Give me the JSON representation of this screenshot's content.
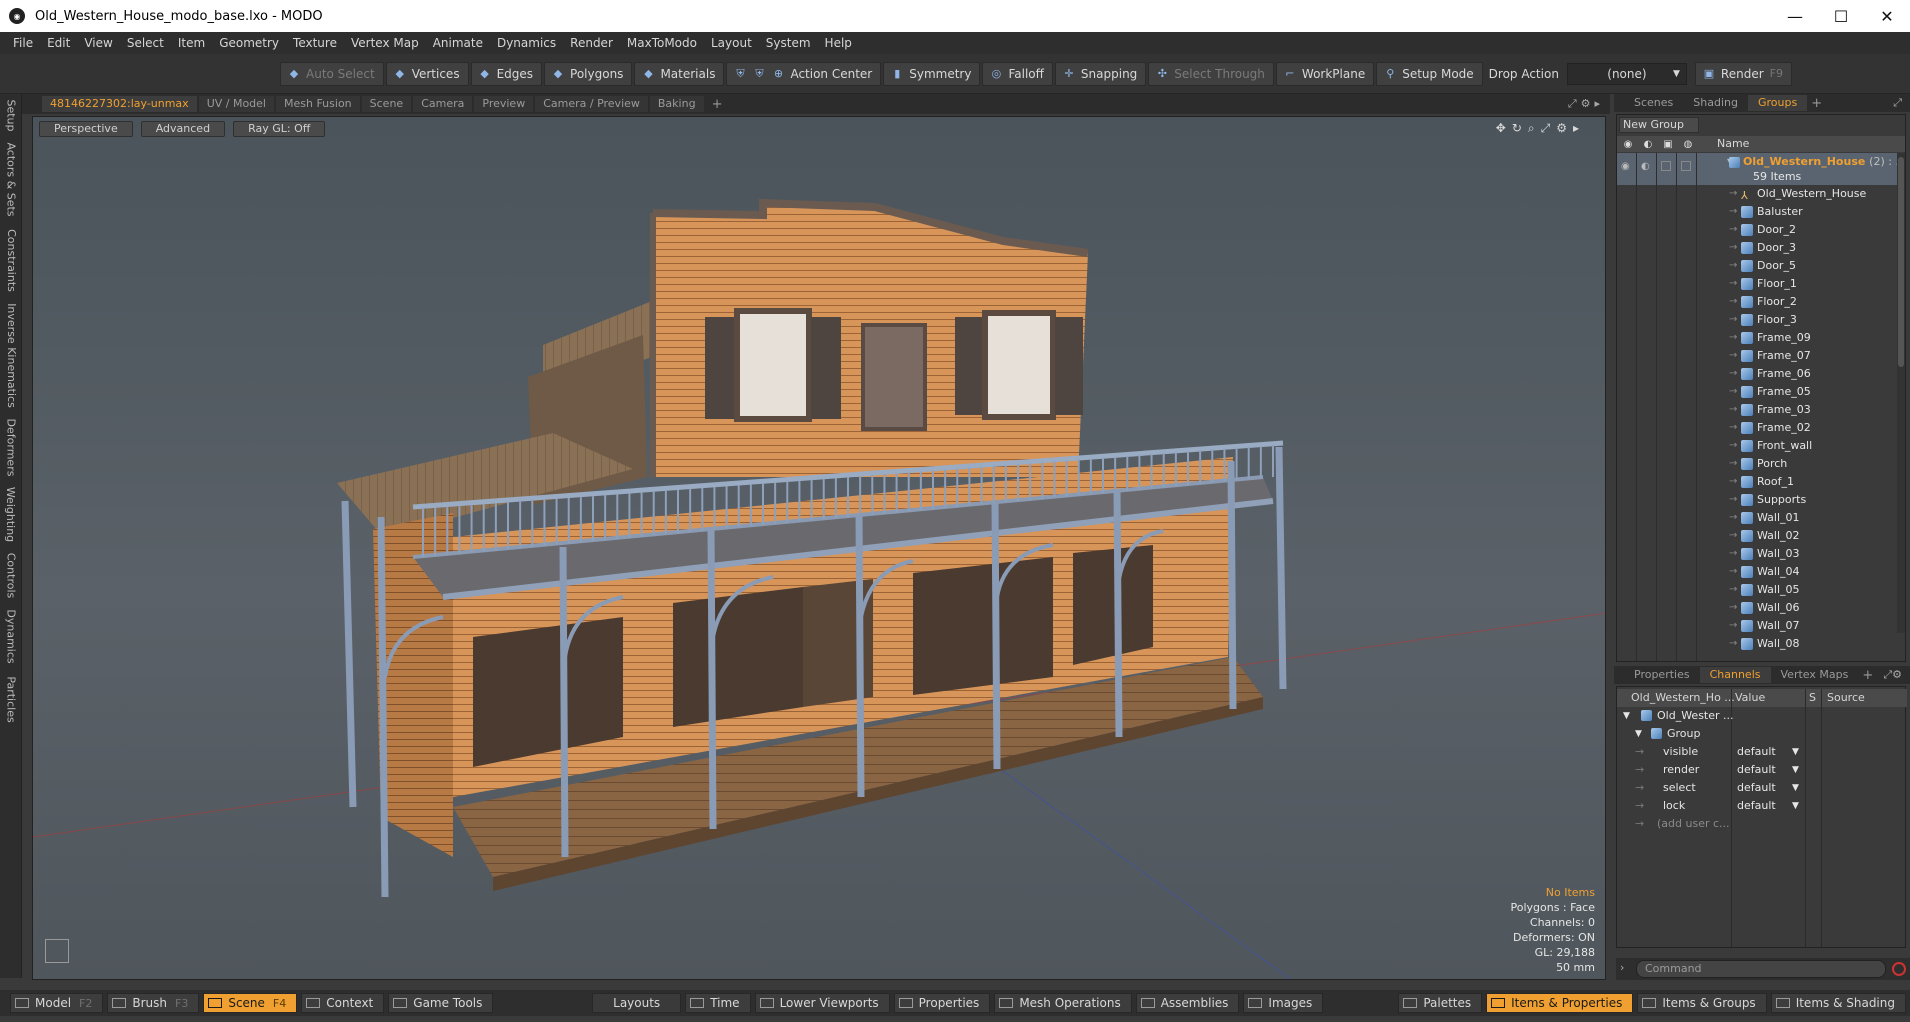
{
  "window": {
    "title": "Old_Western_House_modo_base.lxo - MODO",
    "minimize": "—",
    "maximize": "☐",
    "close": "✕"
  },
  "menu": [
    "File",
    "Edit",
    "View",
    "Select",
    "Item",
    "Geometry",
    "Texture",
    "Vertex Map",
    "Animate",
    "Dynamics",
    "Render",
    "MaxToModo",
    "Layout",
    "System",
    "Help"
  ],
  "toolbar": {
    "auto_select": "Auto Select",
    "vertices": "Vertices",
    "edges": "Edges",
    "polygons": "Polygons",
    "materials": "Materials",
    "action_center": "Action Center",
    "symmetry": "Symmetry",
    "falloff": "Falloff",
    "snapping": "Snapping",
    "select_through": "Select Through",
    "workplane": "WorkPlane",
    "setup_mode": "Setup Mode",
    "drop_action_label": "Drop Action",
    "drop_action_value": "(none)",
    "render": "Render",
    "render_key": "F9"
  },
  "left_tabs": [
    "Setup",
    "Actors & Sets",
    "Constraints",
    "Inverse Kinematics",
    "Deformers",
    "Weighting",
    "Controls",
    "Dynamics",
    "Particles"
  ],
  "viewport_tabs": [
    "48146227302:lay-unmax",
    "UV / Model",
    "Mesh Fusion",
    "Scene",
    "Camera",
    "Preview",
    "Camera / Preview",
    "Baking"
  ],
  "viewport": {
    "perspective": "Perspective",
    "advanced": "Advanced",
    "raygl": "Ray GL: Off",
    "info": {
      "no_items": "No Items",
      "polygons": "Polygons : Face",
      "channels": "Channels: 0",
      "deformers": "Deformers: ON",
      "gl": "GL: 29,188",
      "focal": "50 mm"
    }
  },
  "right_tabs": [
    "Scenes",
    "Shading",
    "Groups"
  ],
  "groups": {
    "new_group": "New Group",
    "name_header": "Name",
    "root_name": "Old_Western_House",
    "root_count": "(2) : ...",
    "root_items": "59 Items",
    "items": [
      "Old_Western_House",
      "Baluster",
      "Door_2",
      "Door_3",
      "Door_5",
      "Floor_1",
      "Floor_2",
      "Floor_3",
      "Frame_09",
      "Frame_07",
      "Frame_06",
      "Frame_05",
      "Frame_03",
      "Frame_02",
      "Front_wall",
      "Porch",
      "Roof_1",
      "Supports",
      "Wall_01",
      "Wall_02",
      "Wall_03",
      "Wall_04",
      "Wall_05",
      "Wall_06",
      "Wall_07",
      "Wall_08"
    ]
  },
  "props_tabs": [
    "Properties",
    "Channels",
    "Vertex Maps"
  ],
  "channels": {
    "col_name": "Old_Western_Ho ...",
    "col_value": "Value",
    "col_s": "S",
    "col_source": "Source",
    "item": "Old_Wester ...",
    "group": "Group",
    "rows": [
      {
        "name": "visible",
        "value": "default"
      },
      {
        "name": "render",
        "value": "default"
      },
      {
        "name": "select",
        "value": "default"
      },
      {
        "name": "lock",
        "value": "default"
      }
    ],
    "add_user": "(add user c..."
  },
  "command": {
    "placeholder": "Command"
  },
  "bottom": {
    "model": "Model",
    "model_key": "F2",
    "brush": "Brush",
    "brush_key": "F3",
    "scene": "Scene",
    "scene_key": "F4",
    "context": "Context",
    "game_tools": "Game Tools",
    "layouts": "Layouts",
    "time": "Time",
    "lower_viewports": "Lower Viewports",
    "properties": "Properties",
    "mesh_operations": "Mesh Operations",
    "assemblies": "Assemblies",
    "images": "Images",
    "palettes": "Palettes",
    "items_properties": "Items & Properties",
    "items_groups": "Items & Groups",
    "items_shading": "Items & Shading"
  },
  "colors": {
    "accent": "#f0a030",
    "bg": "#3a3a3a",
    "viewport": "#5a6168"
  }
}
